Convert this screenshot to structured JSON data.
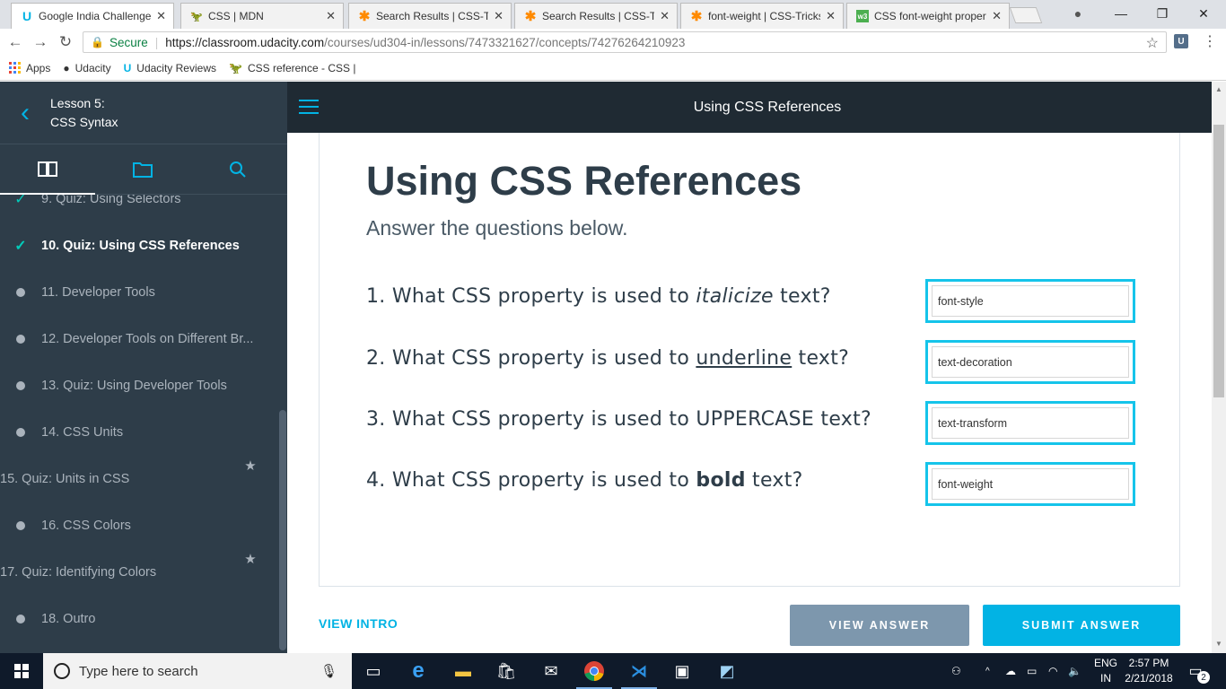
{
  "browser": {
    "tabs": [
      {
        "title": "Google India Challenge",
        "icon": "udacity-icon",
        "color": "#02b3e4"
      },
      {
        "title": "CSS | MDN",
        "icon": "mdn-icon",
        "color": "#2e3d49"
      },
      {
        "title": "Search Results | CSS-Tri",
        "icon": "css-tricks-icon",
        "color": "#ff8a00"
      },
      {
        "title": "Search Results | CSS-Tri",
        "icon": "css-tricks-icon",
        "color": "#ff8a00"
      },
      {
        "title": "font-weight | CSS-Tricks",
        "icon": "css-tricks-icon",
        "color": "#ff8a00"
      },
      {
        "title": "CSS font-weight proper",
        "icon": "w3schools-icon",
        "color": "#4caf50"
      }
    ],
    "secure_label": "Secure",
    "url_host": "https://classroom.udacity.com",
    "url_path": "/courses/ud304-in/lessons/7473321627/concepts/74276264210923",
    "bookmarks": [
      "Apps",
      "Udacity",
      "Udacity Reviews",
      "CSS reference - CSS |"
    ]
  },
  "sidebar": {
    "lesson_line1": "Lesson 5:",
    "lesson_line2": "CSS Syntax",
    "concepts": [
      {
        "label": "9. Quiz: Using Selectors",
        "status": "check"
      },
      {
        "label": "10. Quiz: Using CSS References",
        "status": "check",
        "current": true
      },
      {
        "label": "11. Developer Tools",
        "status": "dot"
      },
      {
        "label": "12. Developer Tools on Different Br...",
        "status": "dot"
      },
      {
        "label": "13. Quiz: Using Developer Tools",
        "status": "dot"
      },
      {
        "label": "14. CSS Units",
        "status": "dot"
      },
      {
        "label": "15. Quiz: Units in CSS",
        "status": "star"
      },
      {
        "label": "16. CSS Colors",
        "status": "dot"
      },
      {
        "label": "17. Quiz: Identifying Colors",
        "status": "star"
      },
      {
        "label": "18. Outro",
        "status": "dot"
      }
    ]
  },
  "main": {
    "header_title": "Using CSS References",
    "heading": "Using CSS References",
    "subheading": "Answer the questions below.",
    "questions": [
      {
        "prefix": "1. What CSS property is used to ",
        "emph": "italicize",
        "suffix": " text?",
        "answer": "font-style"
      },
      {
        "prefix": "2. What CSS property is used to ",
        "emph": "underline",
        "suffix": " text?",
        "answer": "text-decoration"
      },
      {
        "prefix": "3. What CSS property is used to ",
        "emph": "UPPERCASE",
        "suffix": " text?",
        "answer": "text-transform"
      },
      {
        "prefix": "4. What CSS property is used to ",
        "emph": "bold",
        "suffix": " text?",
        "answer": "font-weight"
      }
    ],
    "view_intro": "VIEW INTRO",
    "view_answer": "VIEW ANSWER",
    "submit_answer": "SUBMIT ANSWER"
  },
  "taskbar": {
    "search_placeholder": "Type here to search",
    "lang_line1": "ENG",
    "lang_line2": "IN",
    "time": "2:57 PM",
    "date": "2/21/2018",
    "notification_count": "2"
  }
}
